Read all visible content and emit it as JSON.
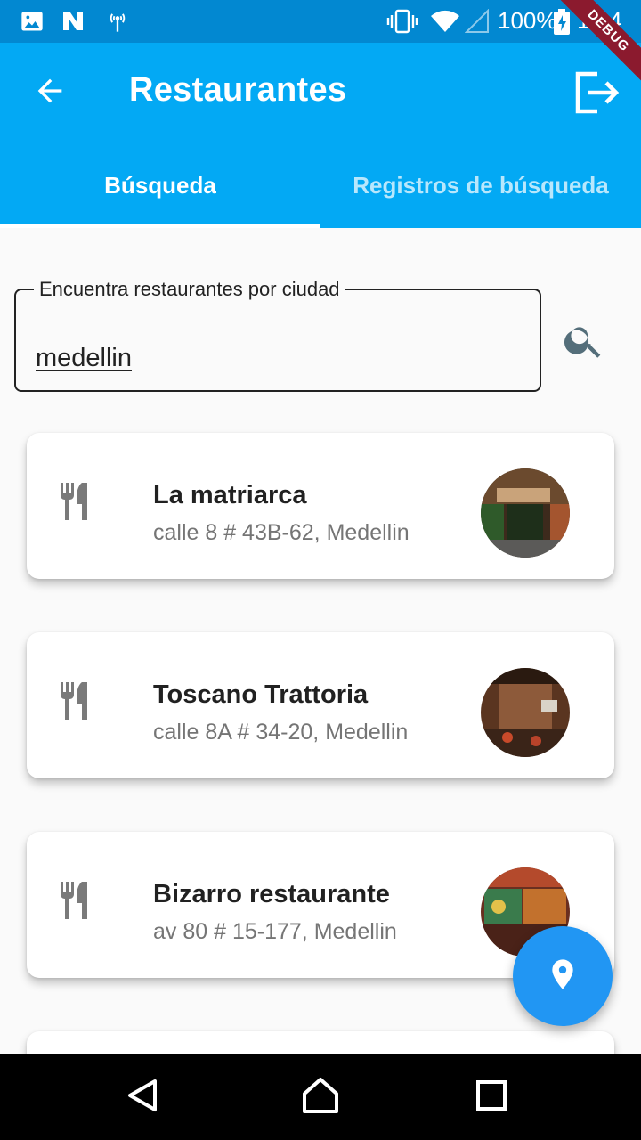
{
  "status_bar": {
    "battery": "100%",
    "time": "1:34",
    "icons": [
      "image-icon",
      "n-app-icon",
      "hotspot-icon",
      "vibrate-icon",
      "wifi-icon",
      "signal-icon",
      "battery-icon"
    ]
  },
  "debug_banner": "DEBUG",
  "app_bar": {
    "title": "Restaurantes",
    "back_icon": "arrow-back-icon",
    "logout_icon": "logout-icon"
  },
  "tabs": [
    {
      "label": "Búsqueda",
      "active": true
    },
    {
      "label": "Registros de búsqueda",
      "active": false
    }
  ],
  "search": {
    "label": "Encuentra restaurantes por ciudad",
    "value": "medellin",
    "button_icon": "search-icon"
  },
  "restaurants": [
    {
      "name": "La matriarca",
      "address": "calle 8 # 43B-62, Medellin",
      "icon": "restaurant-icon"
    },
    {
      "name": "Toscano Trattoria",
      "address": "calle 8A # 34-20, Medellin",
      "icon": "restaurant-icon"
    },
    {
      "name": "Bizarro restaurante",
      "address": "av 80 # 15-177, Medellin",
      "icon": "restaurant-icon"
    }
  ],
  "fab_icon": "location-pin-icon",
  "nav": {
    "back": "nav-back-icon",
    "home": "nav-home-icon",
    "recents": "nav-recents-icon"
  },
  "colors": {
    "status_bar": "#0288d1",
    "app_bar": "#03a9f4",
    "fab": "#2196f3",
    "background": "#fafafa"
  }
}
